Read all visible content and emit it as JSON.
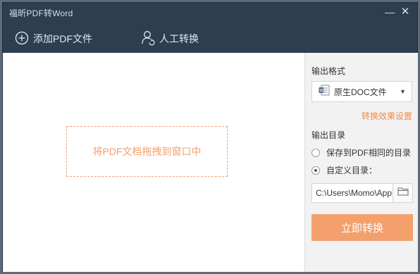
{
  "window": {
    "title": "福昕PDF转Word",
    "minimize_glyph": "—",
    "close_glyph": "✕"
  },
  "toolbar": {
    "add_pdf_label": "添加PDF文件",
    "add_pdf_icon": "plus-circle-icon",
    "manual_label": "人工转换",
    "manual_icon": "person-refresh-icon"
  },
  "main": {
    "drop_hint": "将PDF文档拖拽到窗口中"
  },
  "sidebar": {
    "format_label": "输出格式",
    "format_selected": "原生DOC文件",
    "format_icon": "word-doc-icon",
    "settings_link": "转换效果设置",
    "dir_label": "输出目录",
    "radio_same": "保存到PDF相同的目录",
    "radio_custom": "自定义目录：",
    "radio_selected": "custom",
    "path_value": "C:\\Users\\Momo\\AppData",
    "convert_label": "立即转换"
  },
  "colors": {
    "titlebar_bg": "#2c3e50",
    "accent": "#f4a06c",
    "link": "#f08a48"
  }
}
